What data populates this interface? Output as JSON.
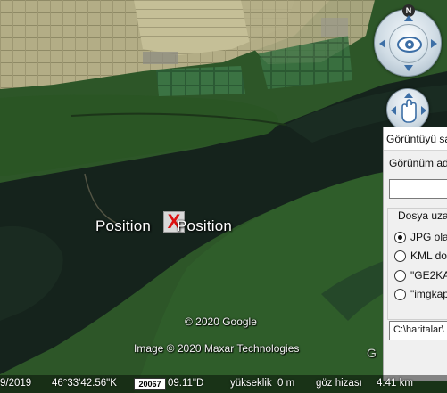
{
  "map": {
    "marker_label_left": "Position",
    "marker_label_right": "Position",
    "marker_glyph": "X",
    "copyright_google": "© 2020 Google",
    "copyright_imagery": "Image © 2020 Maxar Technologies",
    "edge_watermark": "G",
    "colors": {
      "water": "#16241d",
      "land": "#2f5a2c",
      "fields": "#b7b38e",
      "marker": "#dd1111"
    }
  },
  "nav": {
    "north_label": "N",
    "look_icon": "eye-icon",
    "pan_icon": "hand-icon"
  },
  "dialog": {
    "title": "Görüntüyü sa",
    "view_name_label": "Görünüm ad",
    "view_name_value": "",
    "file_extension_label": "Dosya uzan",
    "options": [
      {
        "label": "JPG olar",
        "checked": true
      },
      {
        "label": "KML do",
        "checked": false
      },
      {
        "label": "\"GE2KAP",
        "checked": false
      },
      {
        "label": "\"imgkap",
        "checked": false
      }
    ],
    "path_value": "C:\\haritalar\\"
  },
  "status": {
    "date": "9/2019",
    "latitude": "46°33'42.56\"K",
    "elevation_badge": "20067",
    "longitude": "09.11\"D",
    "elevation_label": "yükseklik",
    "elevation_value": "0 m",
    "eye_altitude_label": "göz hizası",
    "eye_altitude_value": "4.41 km"
  }
}
